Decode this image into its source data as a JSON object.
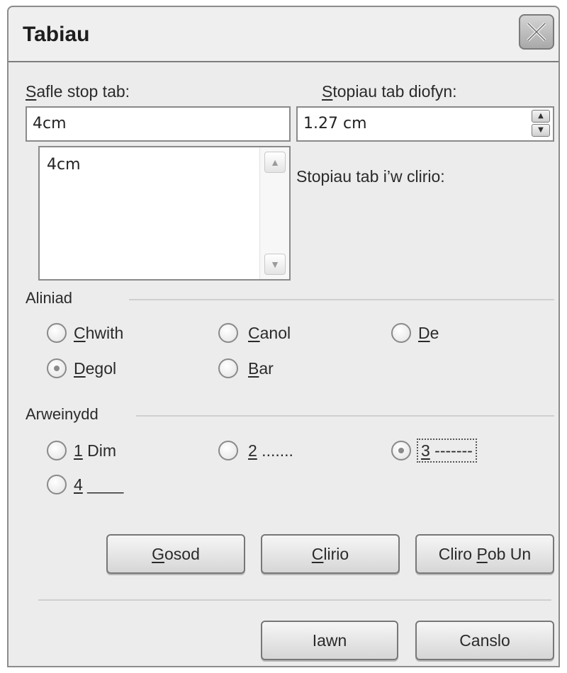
{
  "dialog": {
    "title": "Tabiau",
    "close_icon": "close-icon"
  },
  "tab_position": {
    "label_underlined": "S",
    "label_rest": "afle stop tab:",
    "value": "4cm",
    "list_items": [
      "4cm"
    ]
  },
  "default_tabs": {
    "label_underlined": "S",
    "label_rest": "topiau tab diofyn:",
    "value": "1.27 cm"
  },
  "tabs_to_clear": {
    "label": "Stopiau tab i’w clirio:"
  },
  "alignment": {
    "label": "Aliniad",
    "options": [
      {
        "u": "C",
        "rest": "hwith",
        "checked": false
      },
      {
        "u": "C",
        "rest": "anol",
        "checked": false
      },
      {
        "u": "D",
        "rest": "e",
        "checked": false
      },
      {
        "u": "D",
        "rest": "egol",
        "checked": true
      },
      {
        "u": "B",
        "rest": "ar",
        "checked": false
      }
    ]
  },
  "leader": {
    "label": "Arweinydd",
    "options": [
      {
        "u": "1",
        "rest": " Dim",
        "checked": false
      },
      {
        "u": "2",
        "rest": " .......",
        "checked": false
      },
      {
        "u": "3",
        "rest": " -------",
        "checked": true
      },
      {
        "u": "4",
        "rest": " ____",
        "checked": false
      }
    ]
  },
  "buttons": {
    "set": {
      "u": "G",
      "rest": "osod"
    },
    "clear": {
      "u": "C",
      "rest": "lirio"
    },
    "clear_all_pre": "Cliro ",
    "clear_all_u": "P",
    "clear_all_rest": "ob Un",
    "ok": "Iawn",
    "cancel": "Canslo"
  }
}
